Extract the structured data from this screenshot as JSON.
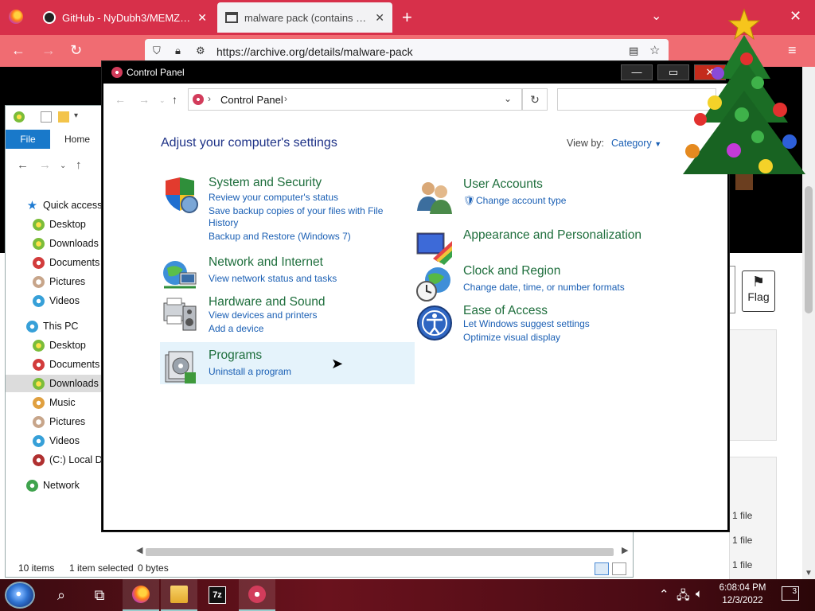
{
  "browser": {
    "tabs": [
      {
        "label": "GitHub - NyDubh3/MEMZ: A tr",
        "active": false
      },
      {
        "label": "malware pack (contains memz",
        "active": true
      }
    ],
    "new_tab": "+",
    "url": "https://archive.org/details/malware-pack",
    "page": {
      "flag_label": "Flag",
      "file_counts": [
        "1 file",
        "1 file",
        "1 file"
      ]
    }
  },
  "explorer": {
    "ribbon": {
      "file": "File",
      "home": "Home"
    },
    "tree": [
      {
        "label": "Quick access",
        "icon": "star-icon"
      },
      {
        "label": "Desktop",
        "icon": "desktop-icon"
      },
      {
        "label": "Downloads",
        "icon": "downloads-icon"
      },
      {
        "label": "Documents",
        "icon": "documents-icon"
      },
      {
        "label": "Pictures",
        "icon": "pictures-icon"
      },
      {
        "label": "Videos",
        "icon": "videos-icon"
      },
      {
        "label": "This PC",
        "icon": "pc-icon"
      },
      {
        "label": "Desktop",
        "icon": "desktop-icon"
      },
      {
        "label": "Documents",
        "icon": "documents-icon"
      },
      {
        "label": "Downloads",
        "icon": "downloads-icon"
      },
      {
        "label": "Music",
        "icon": "music-icon"
      },
      {
        "label": "Pictures",
        "icon": "pictures-icon"
      },
      {
        "label": "Videos",
        "icon": "videos-icon"
      },
      {
        "label": "(C:) Local Di",
        "icon": "drive-icon"
      },
      {
        "label": "Network",
        "icon": "network-icon"
      }
    ],
    "status": {
      "items": "10 items",
      "selected": "1 item selected",
      "size": "0 bytes"
    }
  },
  "control_panel": {
    "title": "Control Panel",
    "breadcrumb": "Control Panel",
    "heading": "Adjust your computer's settings",
    "view_by_label": "View by:",
    "view_by_value": "Category",
    "categories": {
      "system": {
        "title": "System and Security",
        "links": [
          "Review your computer's status",
          "Save backup copies of your files with File",
          "History",
          "Backup and Restore (Windows 7)"
        ]
      },
      "network": {
        "title": "Network and Internet",
        "links": [
          "View network status and tasks"
        ]
      },
      "hardware": {
        "title": "Hardware and Sound",
        "links": [
          "View devices and printers",
          "Add a device"
        ]
      },
      "programs": {
        "title": "Programs",
        "links": [
          "Uninstall a program"
        ]
      },
      "users": {
        "title": "User Accounts",
        "links": [
          "Change account type"
        ]
      },
      "appearance": {
        "title": "Appearance and Personalization",
        "links": []
      },
      "clock": {
        "title": "Clock and Region",
        "links": [
          "Change date, time, or number formats"
        ]
      },
      "ease": {
        "title": "Ease of Access",
        "links": [
          "Let Windows suggest settings",
          "Optimize visual display"
        ]
      }
    }
  },
  "taskbar": {
    "time": "6:08:04 PM",
    "date": "12/3/2022",
    "notifications": "3"
  }
}
